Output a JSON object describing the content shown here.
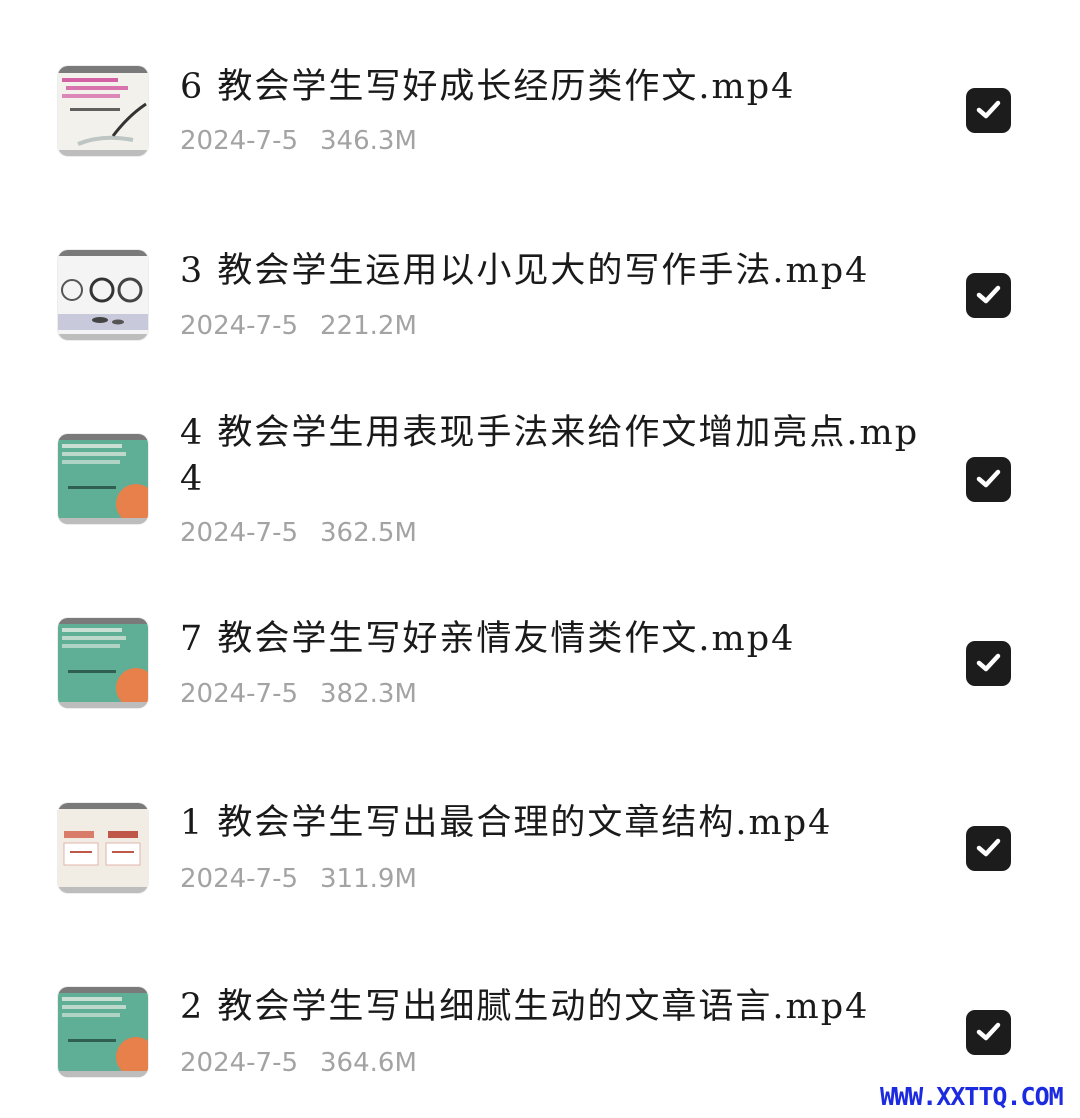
{
  "files": [
    {
      "name": "6 教会学生写好成长经历类作文.mp4",
      "date": "2024-7-5",
      "size": "346.3M",
      "checked": true,
      "thumbnail_icon": "slide-thumbnail-icon"
    },
    {
      "name": "3 教会学生运用以小见大的写作手法.mp4",
      "date": "2024-7-5",
      "size": "221.2M",
      "checked": true,
      "thumbnail_icon": "slide-thumbnail-icon"
    },
    {
      "name": "4 教会学生用表现手法来给作文增加亮点.mp4",
      "date": "2024-7-5",
      "size": "362.5M",
      "checked": true,
      "thumbnail_icon": "slide-thumbnail-icon"
    },
    {
      "name": "7 教会学生写好亲情友情类作文.mp4",
      "date": "2024-7-5",
      "size": "382.3M",
      "checked": true,
      "thumbnail_icon": "slide-thumbnail-icon"
    },
    {
      "name": "1 教会学生写出最合理的文章结构.mp4",
      "date": "2024-7-5",
      "size": "311.9M",
      "checked": true,
      "thumbnail_icon": "slide-thumbnail-icon"
    },
    {
      "name": "2 教会学生写出细腻生动的文章语言.mp4",
      "date": "2024-7-5",
      "size": "364.6M",
      "checked": true,
      "thumbnail_icon": "slide-thumbnail-icon"
    }
  ],
  "watermark": "WWW.XXTTQ.COM",
  "colors": {
    "checkbox": "#1c1c1c",
    "meta_text": "#a3a3a3",
    "title_text": "#1a1a1a",
    "watermark": "#1d2be0"
  }
}
